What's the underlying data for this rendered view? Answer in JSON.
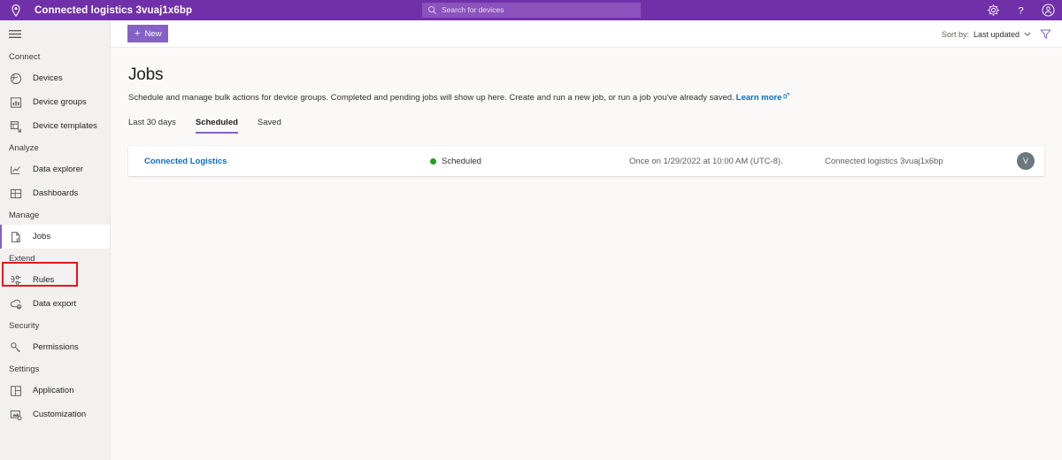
{
  "topbar": {
    "brand_title": "Connected logistics 3vuaj1x6bp",
    "pin_icon": "location-pin-icon",
    "search": {
      "placeholder": "Search for devices",
      "icon": "search-icon"
    },
    "actions": [
      {
        "icon": "gear-icon",
        "name": "settings"
      },
      {
        "icon": "question-mark-icon",
        "name": "help"
      },
      {
        "icon": "account-icon",
        "name": "account"
      }
    ],
    "background": "#7030a8"
  },
  "sidebar": {
    "hamburger_icon": "hamburger-menu-icon",
    "groups": [
      {
        "label": "Connect",
        "items": [
          {
            "label": "Devices",
            "icon": "devices-icon"
          },
          {
            "label": "Device groups",
            "icon": "device-groups-icon"
          },
          {
            "label": "Device templates",
            "icon": "device-templates-icon"
          }
        ]
      },
      {
        "label": "Analyze",
        "items": [
          {
            "label": "Data explorer",
            "icon": "data-explorer-icon"
          },
          {
            "label": "Dashboards",
            "icon": "dashboards-icon"
          }
        ]
      },
      {
        "label": "Manage",
        "items": [
          {
            "label": "Jobs",
            "icon": "jobs-icon",
            "selected": true,
            "highlighted": true
          }
        ]
      },
      {
        "label": "Extend",
        "items": [
          {
            "label": "Rules",
            "icon": "rules-icon"
          },
          {
            "label": "Data export",
            "icon": "data-export-icon"
          }
        ]
      },
      {
        "label": "Security",
        "items": [
          {
            "label": "Permissions",
            "icon": "permissions-key-icon"
          }
        ]
      },
      {
        "label": "Settings",
        "items": [
          {
            "label": "Application",
            "icon": "application-icon"
          },
          {
            "label": "Customization",
            "icon": "customization-icon"
          }
        ]
      }
    ],
    "highlight_color": "#e81123",
    "accent_color": "#8661c5"
  },
  "commandbar": {
    "new_button": {
      "label": "New",
      "plus": "+",
      "color": "#8661c5"
    },
    "sort": {
      "prefix": "Sort by:",
      "value": "Last updated",
      "icon": "chevron-down-icon"
    },
    "filter_icon": "filter-funnel-icon"
  },
  "main": {
    "title": "Jobs",
    "description": "Schedule and manage bulk actions for device groups. Completed and pending jobs will show up here. Create and run a new job, or run a job you've already saved.",
    "learn_more": {
      "label": "Learn more",
      "icon": "external-link-icon",
      "color": "#0f6cbd"
    },
    "tabs": [
      {
        "label": "Last 30 days",
        "active": false
      },
      {
        "label": "Scheduled",
        "active": true
      },
      {
        "label": "Saved",
        "active": false
      }
    ],
    "jobs": [
      {
        "name": "Connected Logistics",
        "status": "Scheduled",
        "status_color": "#22a022",
        "schedule": "Once on 1/29/2022 at 10:00 AM (UTC-8).",
        "device_group": "Connected logistics 3vuaj1x6bp",
        "avatar_initial": "V"
      }
    ]
  }
}
